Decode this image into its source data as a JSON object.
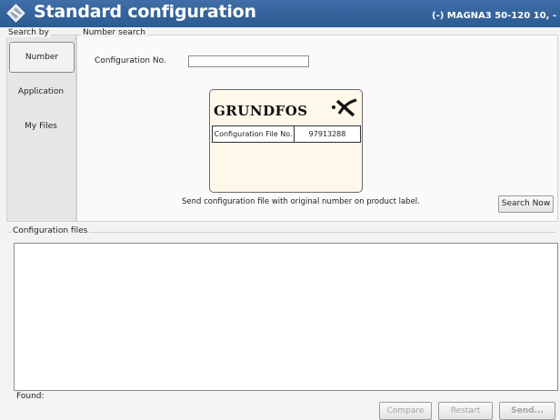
{
  "header": {
    "title": "Standard configuration",
    "device": "(-) MAGNA3 50-120 10, -",
    "icon": "grundfos-diamond-icon",
    "bar_color": "#2e5c94"
  },
  "search_by": {
    "legend": "Search by",
    "items": [
      {
        "label": "Number",
        "active": true
      },
      {
        "label": "Application",
        "active": false
      },
      {
        "label": "My Files",
        "active": false
      }
    ]
  },
  "number_search": {
    "legend": "Number search",
    "field_label": "Configuration No.",
    "field_value": "",
    "label_card": {
      "brand": "GRUNDFOS",
      "brand_mark": "grundfos-x-logo-icon",
      "config_label": "Configuration File No.",
      "config_number": "97913288"
    },
    "hint": "Send configuration file with original number on product label.",
    "search_button": "Search Now"
  },
  "config_files": {
    "legend": "Configuration files",
    "rows": [],
    "found_label": "Found:"
  },
  "actions": {
    "compare": "Compare",
    "restart": "Restart",
    "send": "Send..."
  }
}
